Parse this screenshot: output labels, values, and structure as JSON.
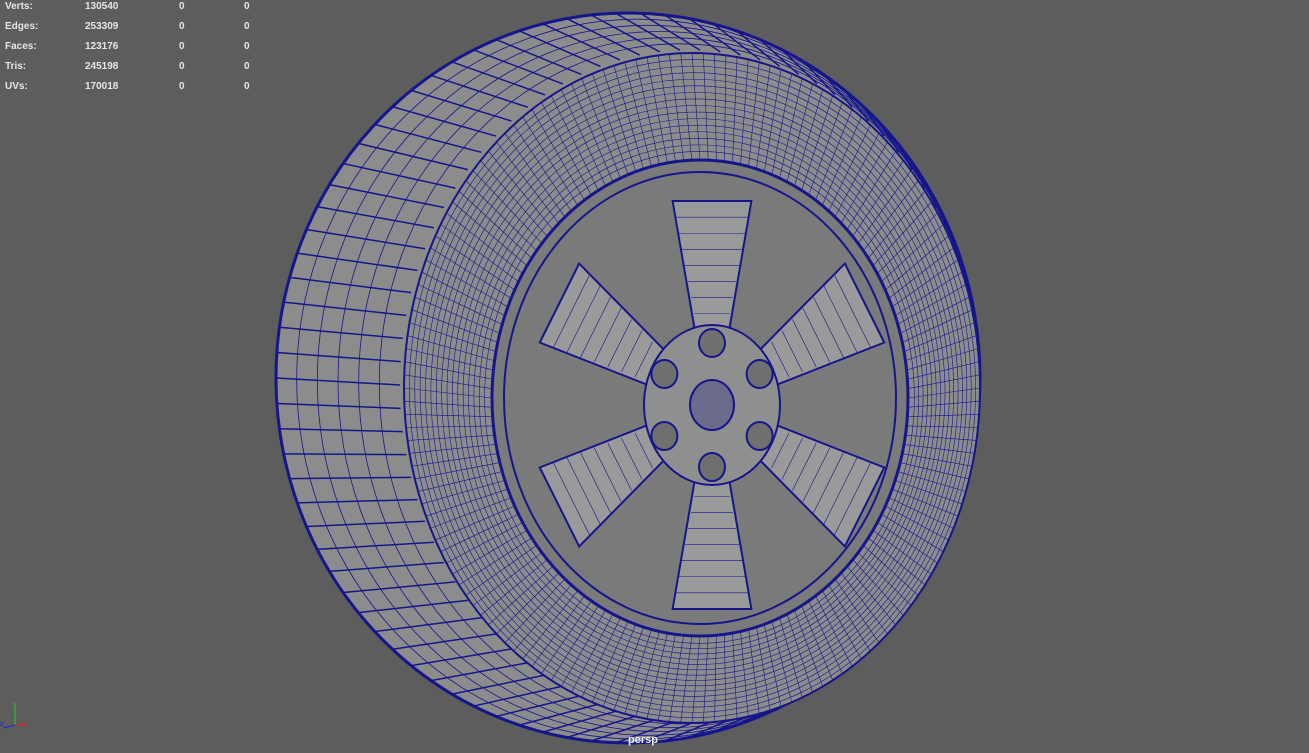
{
  "hud": {
    "rows": [
      {
        "label": "Verts:",
        "values": [
          "130540",
          "0",
          "0"
        ]
      },
      {
        "label": "Edges:",
        "values": [
          "253309",
          "0",
          "0"
        ]
      },
      {
        "label": "Faces:",
        "values": [
          "123176",
          "0",
          "0"
        ]
      },
      {
        "label": "Tris:",
        "values": [
          "245198",
          "0",
          "0"
        ]
      },
      {
        "label": "UVs:",
        "values": [
          "170018",
          "0",
          "0"
        ]
      }
    ]
  },
  "viewport": {
    "camera_label": "persp",
    "axis": {
      "x": "x",
      "y": "y",
      "z": "z"
    },
    "colors": {
      "background": "#5d5d5d",
      "mesh": "#8c8c8c",
      "wire": "#16168c",
      "axis_x": "#e02020",
      "axis_y": "#20d020",
      "axis_z": "#2020e0"
    }
  }
}
